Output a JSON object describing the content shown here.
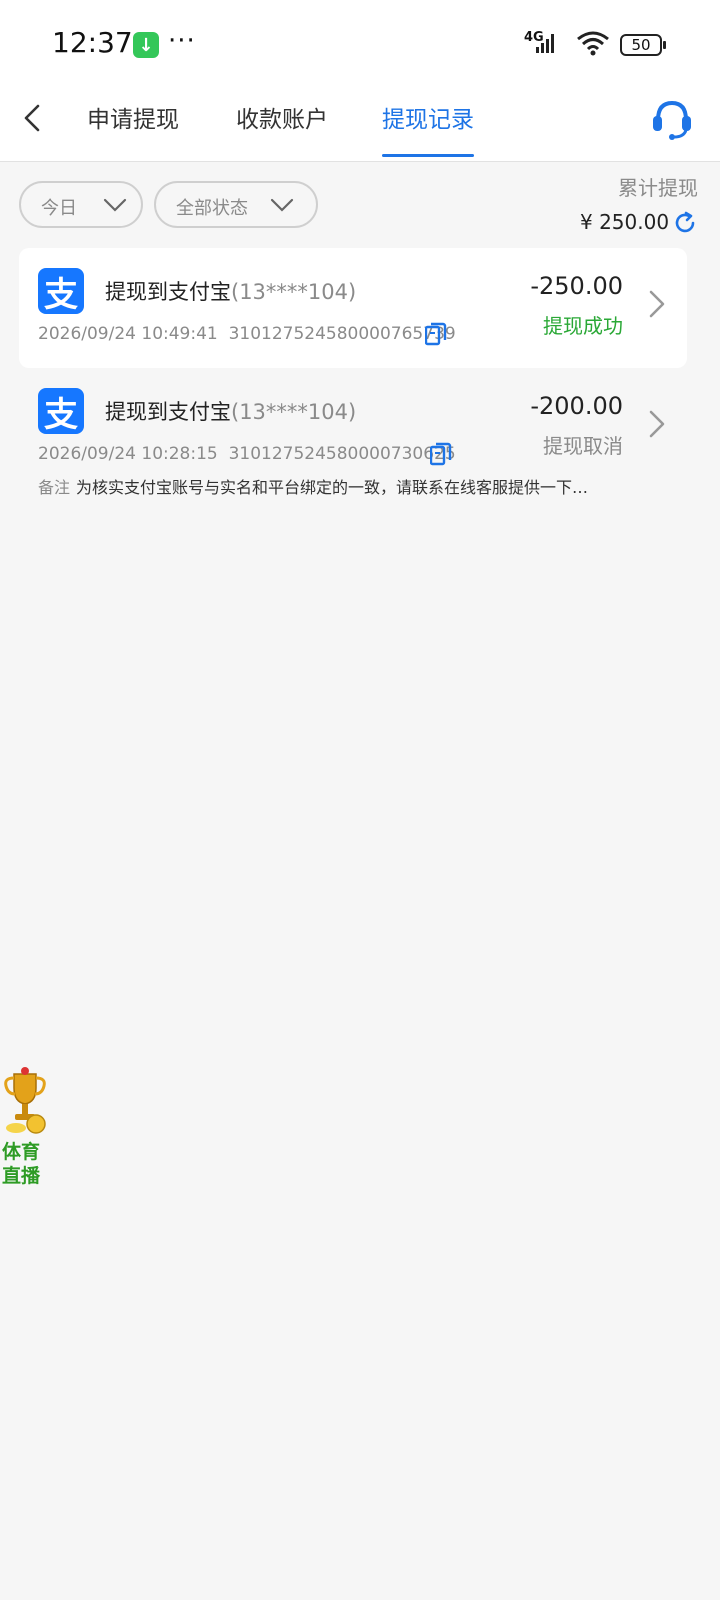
{
  "status_bar": {
    "time": "12:37",
    "dots": "···",
    "network": "4G",
    "battery": "50"
  },
  "header": {
    "tabs": [
      {
        "label": "申请提现"
      },
      {
        "label": "收款账户"
      },
      {
        "label": "提现记录"
      }
    ],
    "active_tab_color": "#1e74e6"
  },
  "filters": {
    "date": "今日",
    "status": "全部状态"
  },
  "summary": {
    "total_label": "累计提现",
    "total_amount": "¥ 250.00"
  },
  "records": [
    {
      "icon_text": "支",
      "title": "提现到支付宝",
      "account": "(13****104)",
      "datetime": "2026/09/24 10:49:41",
      "order_id": "310127524580000765739",
      "amount": "-250.00",
      "status": "提现成功"
    },
    {
      "icon_text": "支",
      "title": "提现到支付宝",
      "account": "(13****104)",
      "datetime": "2026/09/24 10:28:15",
      "order_id": "310127524580000730625",
      "amount": "-200.00",
      "status": "提现取消",
      "note_label": "备注",
      "note": "为核实支付宝账号与实名和平台绑定的一致，请联系在线客服提供一下…"
    }
  ],
  "float_widget": {
    "line1": "体育",
    "line2": "直播"
  },
  "colors": {
    "accent": "#1e74e6",
    "success": "#2aa836",
    "alipay": "#1677ff"
  }
}
